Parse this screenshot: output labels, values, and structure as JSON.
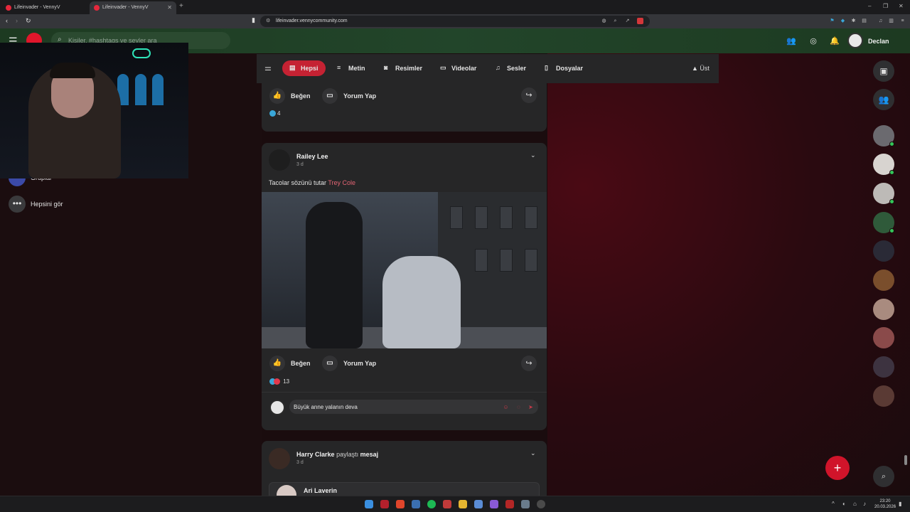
{
  "browser": {
    "tabs": [
      {
        "label": "Lifeinvader - VennyV",
        "active": false
      },
      {
        "label": "Lifeinvader - VennyV",
        "active": true
      }
    ],
    "url": "lifeinvader.vennycommunity.com"
  },
  "app": {
    "search_placeholder": "Kişiler, #hashtags ve şeyler ara",
    "user_name": "Declan"
  },
  "left_sidebar": {
    "partial_item": "Gruplar",
    "see_all": "Hepsini gör"
  },
  "filters": [
    {
      "label": "Hepsi",
      "icon": "document-icon",
      "active": true
    },
    {
      "label": "Metin",
      "icon": "text-icon",
      "active": false
    },
    {
      "label": "Resimler",
      "icon": "camera-icon",
      "active": false
    },
    {
      "label": "Videolar",
      "icon": "video-icon",
      "active": false
    },
    {
      "label": "Sesler",
      "icon": "music-icon",
      "active": false
    },
    {
      "label": "Dosyalar",
      "icon": "file-icon",
      "active": false
    }
  ],
  "top_label": "Üst",
  "post_prev": {
    "like_label": "Beğen",
    "comment_label": "Yorum Yap",
    "reaction_count": "4"
  },
  "post_main": {
    "author": "Railey Lee",
    "time": "3 d",
    "text": "Tacolar sözünü tutar",
    "mention": "Trey Cole",
    "like_label": "Beğen",
    "comment_label": "Yorum Yap",
    "reaction_count": "13",
    "comment_draft": "Büyük anne yalanın deva"
  },
  "post_next": {
    "author": "Harry Clarke",
    "shared_word": "paylaştı",
    "shared_type": "mesaj",
    "time": "3 d",
    "sub_author": "Ari Laverin"
  },
  "taskbar": {
    "time": "23:20",
    "date": "20.03.2026"
  },
  "colors": {
    "accent": "#c52233",
    "appbar": "#1f3a22",
    "card": "#262627"
  }
}
